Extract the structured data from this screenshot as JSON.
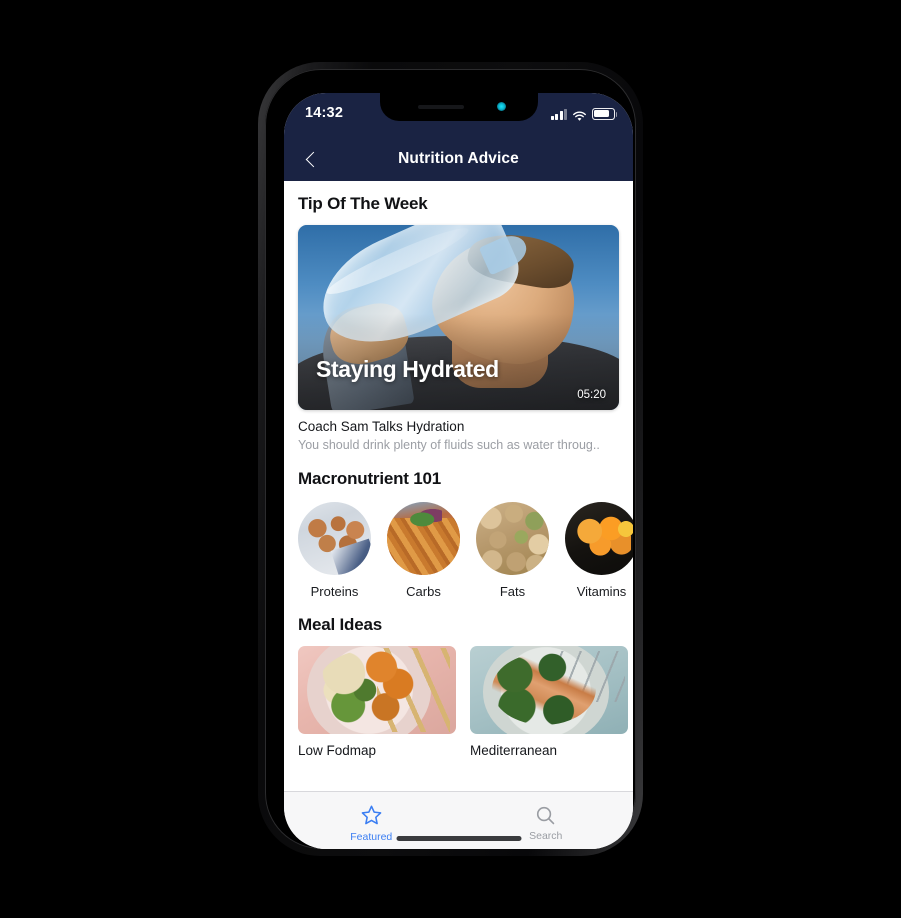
{
  "status_bar": {
    "time": "14:32",
    "signal_icon": "cellular-signal-icon",
    "wifi_icon": "wifi-icon",
    "battery_icon": "battery-icon"
  },
  "nav": {
    "title": "Nutrition Advice",
    "back_icon": "chevron-left-icon"
  },
  "theme": {
    "nav_background": "#1a2343",
    "accent": "#3b7ef2",
    "screen_background": "#ffffff",
    "tabbar_background": "#f7f7f8",
    "muted_text": "#9b9ea4"
  },
  "sections": {
    "tip": {
      "title": "Tip Of The Week",
      "video": {
        "overlay_title": "Staying Hydrated",
        "duration": "05:20",
        "image_alt": "man-drinking-water-bottle-photo"
      },
      "caption_title": "Coach Sam Talks Hydration",
      "caption_desc": "You should drink plenty of fluids such as water throug.."
    },
    "macros": {
      "title": "Macronutrient 101",
      "items": [
        {
          "label": "Proteins",
          "image_alt": "eggs-photo"
        },
        {
          "label": "Carbs",
          "image_alt": "pasta-photo"
        },
        {
          "label": "Fats",
          "image_alt": "mixed-nuts-photo"
        },
        {
          "label": "Vitamins",
          "image_alt": "citrus-oranges-photo"
        }
      ]
    },
    "meals": {
      "title": "Meal Ideas",
      "items": [
        {
          "label": "Low Fodmap",
          "image_alt": "grain-bowl-photo"
        },
        {
          "label": "Mediterranean",
          "image_alt": "salmon-broccoli-plate-photo"
        }
      ]
    }
  },
  "tabbar": {
    "tabs": [
      {
        "label": "Featured",
        "icon": "star-icon",
        "active": true
      },
      {
        "label": "Search",
        "icon": "search-icon",
        "active": false
      }
    ]
  }
}
